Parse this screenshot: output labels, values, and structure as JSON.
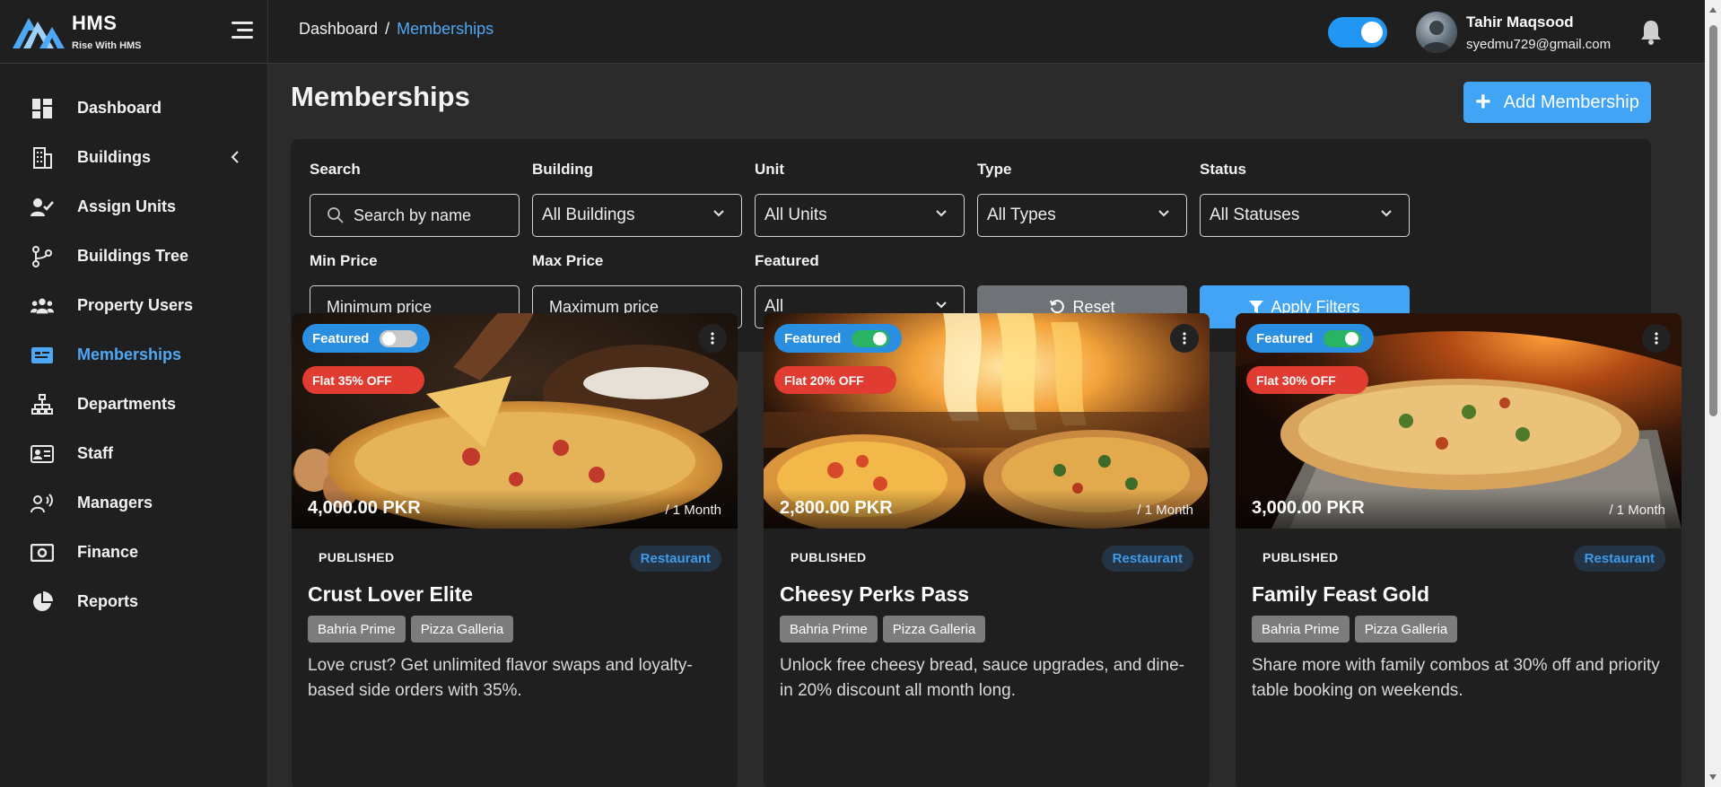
{
  "brand": {
    "name": "HMS",
    "tagline": "Rise With HMS"
  },
  "sidebar": {
    "items": [
      {
        "label": "Dashboard",
        "icon": "dashboard-icon"
      },
      {
        "label": "Buildings",
        "icon": "building-icon"
      },
      {
        "label": "Assign Units",
        "icon": "user-check-icon"
      },
      {
        "label": "Buildings Tree",
        "icon": "tree-icon"
      },
      {
        "label": "Property Users",
        "icon": "users-icon"
      },
      {
        "label": "Memberships",
        "icon": "membership-card-icon"
      },
      {
        "label": "Departments",
        "icon": "sitemap-icon"
      },
      {
        "label": "Staff",
        "icon": "id-card-icon"
      },
      {
        "label": "Managers",
        "icon": "user-voice-icon"
      },
      {
        "label": "Finance",
        "icon": "money-icon"
      },
      {
        "label": "Reports",
        "icon": "pie-chart-icon"
      }
    ],
    "active": "Memberships"
  },
  "header": {
    "breadcrumb": {
      "root": "Dashboard",
      "separator": "/",
      "current": "Memberships"
    },
    "user": {
      "name": "Tahir Maqsood",
      "email": "syedmu729@gmail.com"
    }
  },
  "page": {
    "title": "Memberships",
    "add_button": "Add Membership"
  },
  "filters": {
    "search": {
      "label": "Search",
      "placeholder": "Search by name"
    },
    "building": {
      "label": "Building",
      "value": "All Buildings"
    },
    "unit": {
      "label": "Unit",
      "value": "All Units"
    },
    "type": {
      "label": "Type",
      "value": "All Types"
    },
    "status": {
      "label": "Status",
      "value": "All Statuses"
    },
    "min_price": {
      "label": "Min Price",
      "placeholder": "Minimum price"
    },
    "max_price": {
      "label": "Max Price",
      "placeholder": "Maximum price"
    },
    "featured": {
      "label": "Featured",
      "value": "All"
    },
    "reset": "Reset",
    "apply": "Apply Filters"
  },
  "cards": [
    {
      "featured_label": "Featured",
      "featured_on": false,
      "discount": "Flat 35% OFF",
      "price": "4,000.00 PKR",
      "period": "/ 1 Month",
      "status": "PUBLISHED",
      "type": "Restaurant",
      "title": "Crust Lover Elite",
      "tags": [
        "Bahria Prime",
        "Pizza Galleria"
      ],
      "description": "Love crust? Get unlimited flavor swaps and loyalty-based side orders with 35%."
    },
    {
      "featured_label": "Featured",
      "featured_on": true,
      "discount": "Flat 20% OFF",
      "price": "2,800.00 PKR",
      "period": "/ 1 Month",
      "status": "PUBLISHED",
      "type": "Restaurant",
      "title": "Cheesy Perks Pass",
      "tags": [
        "Bahria Prime",
        "Pizza Galleria"
      ],
      "description": "Unlock free cheesy bread, sauce upgrades, and dine-in 20% discount all month long."
    },
    {
      "featured_label": "Featured",
      "featured_on": true,
      "discount": "Flat 30% OFF",
      "price": "3,000.00 PKR",
      "period": "/ 1 Month",
      "status": "PUBLISHED",
      "type": "Restaurant",
      "title": "Family Feast Gold",
      "tags": [
        "Bahria Prime",
        "Pizza Galleria"
      ],
      "description": "Share more with family combos at 30% off and priority table booking on weekends."
    }
  ],
  "colors": {
    "accent": "#41a4f5",
    "discount": "#e03c31",
    "toggle_on": "#28b463",
    "sidebar_bg": "#1f1f1f",
    "page_bg": "#2b2b2b"
  }
}
